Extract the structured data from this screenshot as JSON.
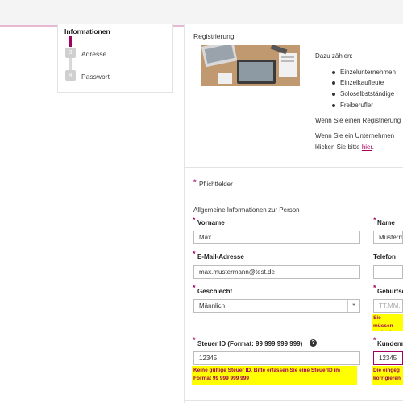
{
  "stepper": {
    "title": "Informationen",
    "steps": [
      {
        "number": "3",
        "label": "Adresse"
      },
      {
        "number": "4",
        "label": "Passwort"
      }
    ]
  },
  "intro": {
    "heading": "Registrierung",
    "dazu": "Dazu zählen:",
    "bullets": [
      "Einzelunternehmen",
      "Einzelkaufleute",
      "Soloselbstständige",
      "Freiberufler"
    ],
    "text1": "Wenn Sie einen Registrierung",
    "text2": "Wenn Sie ein Unternehmen",
    "text3_prefix": "klicken Sie bitte ",
    "link": "hier",
    "text3_suffix": "."
  },
  "form": {
    "required_marker": "*",
    "required_note": "Pflichtfelder",
    "section_title": "Allgemeine Informationen zur Person",
    "fields": {
      "vorname": {
        "label": "Vorname",
        "value": "Max"
      },
      "name": {
        "label": "Name",
        "value": "Musterm"
      },
      "email": {
        "label": "E-Mail-Adresse",
        "value": "max.mustermann@test.de"
      },
      "telefon": {
        "label": "Telefon",
        "value": ""
      },
      "geschlecht": {
        "label": "Geschlecht",
        "value": "Männlich"
      },
      "geburtsdatum": {
        "label": "Geburtsd",
        "placeholder": "TT.MM.",
        "error": "Sie müssen registrieren"
      },
      "steuer_id": {
        "label": "Steuer ID (Format: 99 999 999 999)",
        "value": "12345",
        "error": "Keine gültige Steuer ID. Bitte erfassen Sie eine SteuerID im Format 99 999 999 999"
      },
      "kundennummer": {
        "label": "Kundenn",
        "value": "12345",
        "error": "Die eingeg korrigieren"
      }
    }
  },
  "colors": {
    "accent": "#a3005f",
    "error_bg": "#ffff00"
  }
}
